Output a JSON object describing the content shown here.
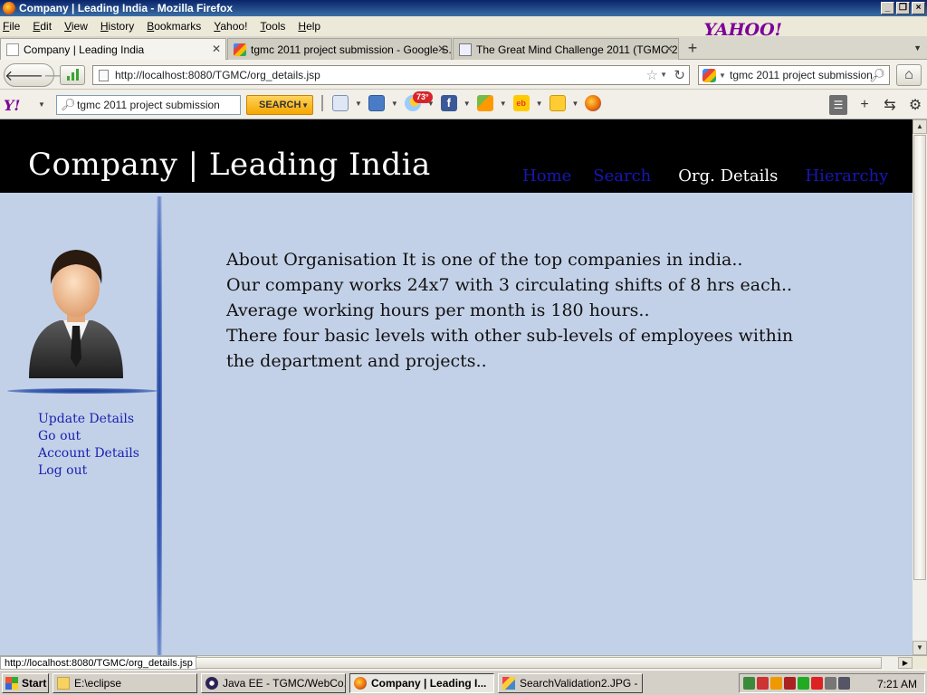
{
  "window": {
    "title": "Company | Leading India - Mozilla Firefox"
  },
  "menu": [
    "File",
    "Edit",
    "View",
    "History",
    "Bookmarks",
    "Yahoo!",
    "Tools",
    "Help"
  ],
  "yahoo_logo": "YAHOO!",
  "tabs": [
    {
      "label": "Company | Leading India",
      "active": true
    },
    {
      "label": "tgmc 2011 project submission - Google S...",
      "active": false
    },
    {
      "label": "The Great Mind Challenge 2011 (TGMC 2...",
      "active": false
    }
  ],
  "address": {
    "url": "http://localhost:8080/TGMC/org_details.jsp"
  },
  "search": {
    "engine": "Google",
    "value": "tgmc 2011 project submission"
  },
  "yahoo_toolbar": {
    "logo": "Y!",
    "search_value": "tgmc 2011 project submission",
    "search_button": "SEARCH",
    "weather_badge": "73°"
  },
  "site": {
    "brand": "Company | Leading India",
    "nav": [
      "Home",
      "Search",
      "Org. Details",
      "Hierarchy"
    ],
    "current_nav": "Org. Details",
    "side_links": [
      "Update Details",
      "Go out",
      "Account Details",
      "Log out"
    ],
    "content": [
      "About Organisation It is one of the top companies in india..",
      "Our company works 24x7 with 3 circulating shifts of 8 hrs each..",
      "Average working hours per month is 180 hours..",
      "There four basic levels with other sub-levels of employees within",
      "the department and projects.."
    ]
  },
  "status": {
    "text": "http://localhost:8080/TGMC/org_details.jsp"
  },
  "taskbar": {
    "start": "Start",
    "items": [
      {
        "label": "E:\\eclipse",
        "active": false
      },
      {
        "label": "Java EE - TGMC/WebCo...",
        "active": false
      },
      {
        "label": "Company | Leading I...",
        "active": true
      },
      {
        "label": "SearchValidation2.JPG - ...",
        "active": false
      }
    ],
    "clock": "7:21 AM"
  },
  "colors": {
    "header_bg": "#000000",
    "page_bg": "#c3d1e8",
    "link": "#1a22b0",
    "nav_active": "#ffffff"
  }
}
